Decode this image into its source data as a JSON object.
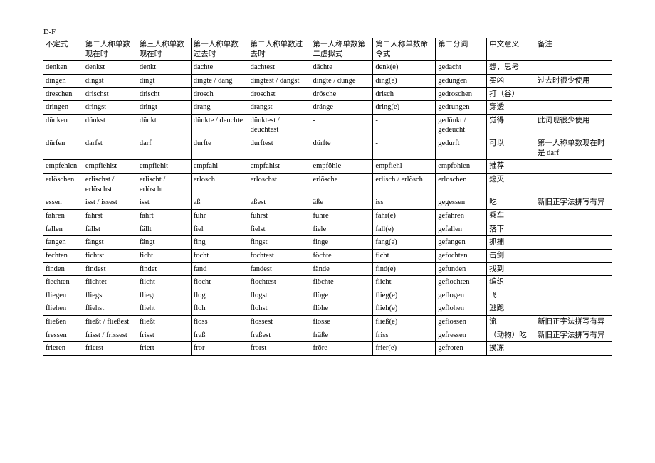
{
  "title": "D-F",
  "headers": [
    "不定式",
    "第二人称单数现在时",
    "第三人称单数现在时",
    "第一人称单数过去时",
    "第二人称单数过去时",
    "第一人称单数第二虚拟式",
    "第二人称单数命令式",
    "第二分词",
    "中文意义",
    "备注"
  ],
  "rows": [
    [
      "denken",
      "denkst",
      "denkt",
      "dachte",
      "dachtest",
      "dächte",
      "denk(e)",
      "gedacht",
      "想，思考",
      ""
    ],
    [
      "dingen",
      "dingst",
      "dingt",
      "dingte / dang",
      "dingtest / dangst",
      "dingte / dünge",
      "ding(e)",
      "gedungen",
      "买凶",
      "过去时很少使用"
    ],
    [
      "dreschen",
      "drischst",
      "drischt",
      "drosch",
      "droschst",
      "drösche",
      "drisch",
      "gedroschen",
      "打（谷）",
      ""
    ],
    [
      "dringen",
      "dringst",
      "dringt",
      "drang",
      "drangst",
      "dränge",
      "dring(e)",
      "gedrungen",
      "穿透",
      ""
    ],
    [
      "dünken",
      "dünkst",
      "dünkt",
      "dünkte / deuchte",
      "dünktest / deuchtest",
      "-",
      "-",
      "gedünkt / gedeucht",
      "觉得",
      "此词现很少使用"
    ],
    [
      "dürfen",
      "darfst",
      "darf",
      "durfte",
      "durftest",
      "dürfte",
      "-",
      "gedurft",
      "可以",
      "第一人称单数现在时是 darf"
    ],
    [
      "empfehlen",
      "empfiehlst",
      "empfiehlt",
      "empfahl",
      "empfahlst",
      "empföhle",
      "empfiehl",
      "empfohlen",
      "推荐",
      ""
    ],
    [
      "erlöschen",
      "erlischst / erlöschst",
      "erlischt / erlöscht",
      "erlosch",
      "erloschst",
      "erlösche",
      "erlisch / erlösch",
      "erloschen",
      "熄灭",
      ""
    ],
    [
      "essen",
      "isst / issest",
      "isst",
      "aß",
      "aßest",
      "äße",
      "iss",
      "gegessen",
      "吃",
      "新旧正字法拼写有异"
    ],
    [
      "fahren",
      "fährst",
      "fährt",
      "fuhr",
      "fuhrst",
      "führe",
      "fahr(e)",
      "gefahren",
      "乘车",
      ""
    ],
    [
      "fallen",
      "fällst",
      "fällt",
      "fiel",
      "fielst",
      "fiele",
      "fall(e)",
      "gefallen",
      "落下",
      ""
    ],
    [
      "fangen",
      "fängst",
      "fängt",
      "fing",
      "fingst",
      "finge",
      "fang(e)",
      "gefangen",
      "抓捕",
      ""
    ],
    [
      "fechten",
      "fichtst",
      "ficht",
      "focht",
      "fochtest",
      "föchte",
      "ficht",
      "gefochten",
      "击剑",
      ""
    ],
    [
      "finden",
      "findest",
      "findet",
      "fand",
      "fandest",
      "fände",
      "find(e)",
      "gefunden",
      "找到",
      ""
    ],
    [
      "flechten",
      "flichtet",
      "flicht",
      "flocht",
      "flochtest",
      "flöchte",
      "flicht",
      "geflochten",
      "编织",
      ""
    ],
    [
      "fliegen",
      "fliegst",
      "fliegt",
      "flog",
      "flogst",
      "flöge",
      "flieg(e)",
      "geflogen",
      "飞",
      ""
    ],
    [
      "fliehen",
      "fliehst",
      "flieht",
      "floh",
      "flohst",
      "flöhe",
      "flieh(e)",
      "geflohen",
      "逃跑",
      ""
    ],
    [
      "fließen",
      "fließt / fließest",
      "fließt",
      "floss",
      "flossest",
      "flösse",
      "fließ(e)",
      "geflossen",
      "流",
      "新旧正字法拼写有异"
    ],
    [
      "fressen",
      "frisst / frissest",
      "frisst",
      "fraß",
      "fraßest",
      "fräße",
      "friss",
      "gefressen",
      "（动物）吃",
      "新旧正字法拼写有异"
    ],
    [
      "frieren",
      "frierst",
      "friert",
      "fror",
      "frorst",
      "fröre",
      "frier(e)",
      "gefroren",
      "挨冻",
      ""
    ]
  ]
}
